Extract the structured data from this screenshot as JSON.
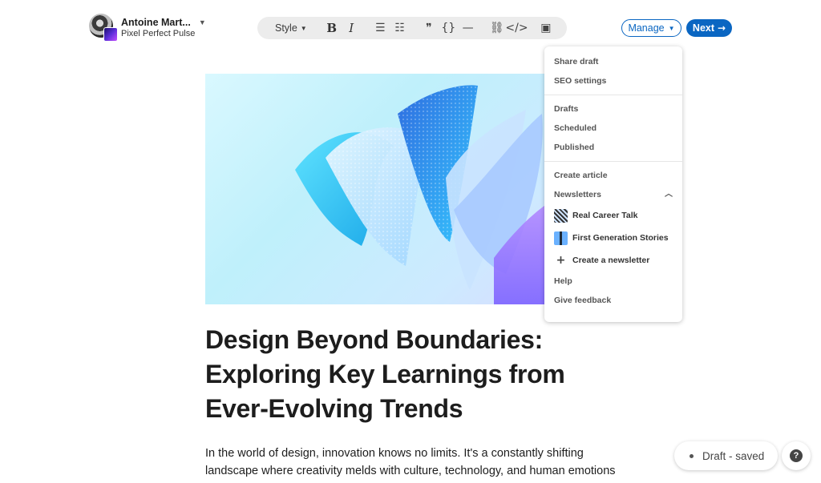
{
  "author": {
    "name": "Antoine Mart...",
    "page": "Pixel Perfect Pulse"
  },
  "toolbar": {
    "style_label": "Style",
    "bold": "B",
    "italic": "I",
    "bulleted_list_icon": "☰",
    "numbered_list_icon": "☷",
    "quote_icon": "❞",
    "code_block_icon": "{}",
    "divider_icon": "—",
    "link_icon": "⛓",
    "embed_icon": "</>",
    "image_icon": "▣"
  },
  "header": {
    "manage_label": "Manage",
    "next_label": "Next",
    "colors": {
      "accent": "#0a66c2"
    }
  },
  "menu": {
    "group1": [
      "Share draft",
      "SEO settings"
    ],
    "group2": [
      "Drafts",
      "Scheduled",
      "Published"
    ],
    "create_article": "Create article",
    "newsletters_label": "Newsletters",
    "newsletters": [
      "Real Career Talk",
      "First Generation Stories"
    ],
    "create_newsletter": "Create a newsletter",
    "help": "Help",
    "feedback": "Give feedback"
  },
  "article": {
    "title": "Design Beyond Boundaries: Exploring Key Learnings from Ever-Evolving Trends",
    "body": "In the world of design, innovation knows no limits. It's a constantly shifting landscape where creativity melds with culture, technology, and human emotions to"
  },
  "status": {
    "draft": "Draft - saved",
    "help": "?"
  }
}
